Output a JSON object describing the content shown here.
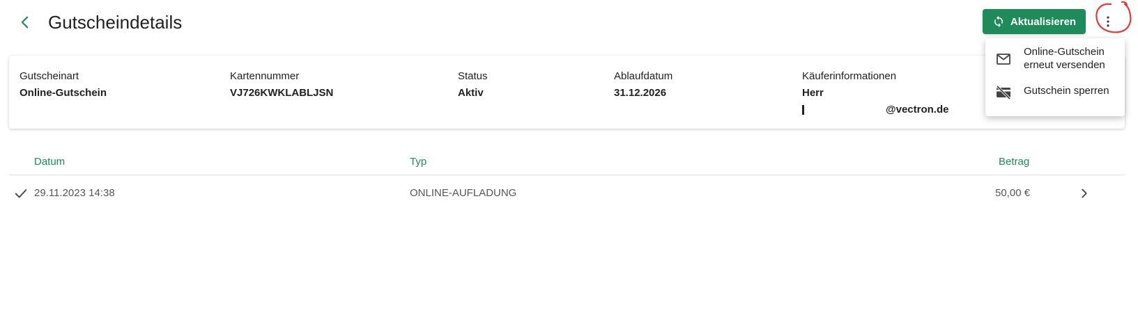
{
  "header": {
    "back_icon": "chevron-left-icon",
    "title": "Gutscheindetails",
    "refresh_label": "Aktualisieren",
    "refresh_icon": "sync-icon",
    "more_icon": "more-vert-icon",
    "accent_color": "#1f8a5a",
    "annotation_color": "#e53935"
  },
  "voucher": {
    "type": {
      "label": "Gutscheinart",
      "value": "Online-Gutschein"
    },
    "card_number": {
      "label": "Kartennummer",
      "value": "VJ726KWKLABLJSN"
    },
    "status": {
      "label": "Status",
      "value": "Aktiv"
    },
    "expiry": {
      "label": "Ablaufdatum",
      "value": "31.12.2026"
    },
    "buyer": {
      "label": "Käuferinformationen",
      "name": "Herr",
      "email": "@vectron.de"
    }
  },
  "transactions": {
    "columns": {
      "date": "Datum",
      "type": "Typ",
      "amount": "Betrag"
    },
    "rows": [
      {
        "status_icon": "check-icon",
        "date": "29.11.2023 14:38",
        "type": "ONLINE-AUFLADUNG",
        "amount": "50,00 €"
      }
    ]
  },
  "menu": {
    "items": [
      {
        "icon": "mail-icon",
        "label_line1": "Online-Gutschein",
        "label_line2": "erneut versenden"
      },
      {
        "icon": "card-off-icon",
        "label": "Gutschein sperren"
      }
    ]
  }
}
